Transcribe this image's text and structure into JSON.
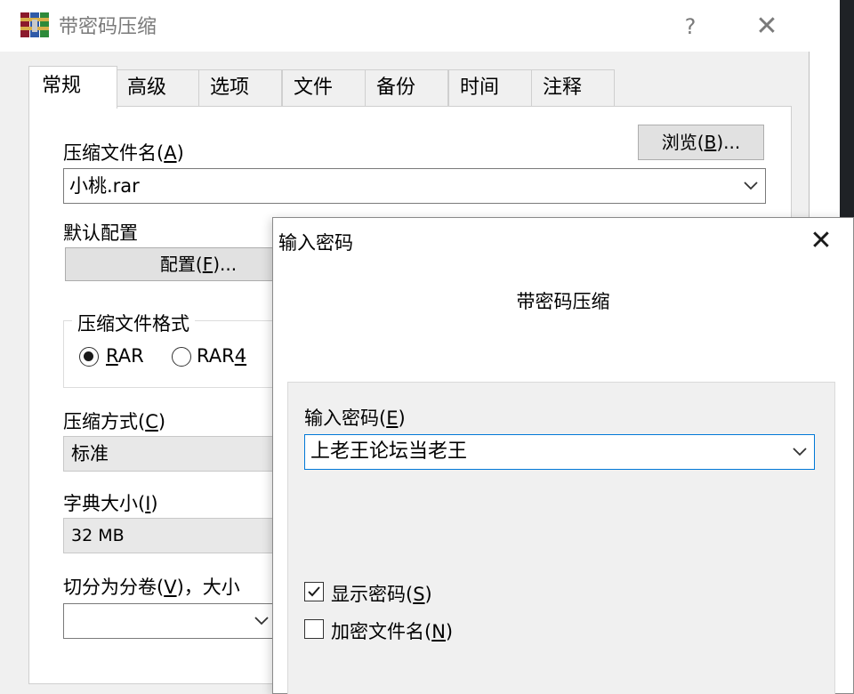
{
  "window": {
    "title": "带密码压缩",
    "help": "?",
    "close": "✕"
  },
  "tabs": [
    "常规",
    "高级",
    "选项",
    "文件",
    "备份",
    "时间",
    "注释"
  ],
  "general": {
    "archive_name_label": "压缩文件名",
    "archive_name_key": "A",
    "browse_label": "浏览",
    "browse_key": "B",
    "browse_suffix": "...",
    "archive_name_value": "小桃.rar",
    "default_profile_label": "默认配置",
    "profile_button_label": "配置",
    "profile_button_key": "F",
    "profile_button_suffix": "...",
    "format_group_title": "压缩文件格式",
    "format_options": [
      {
        "label": "RAR",
        "selected": true
      },
      {
        "label": "RAR4",
        "selected": false
      }
    ],
    "method_label": "压缩方式",
    "method_key": "C",
    "method_value": "标准",
    "dict_label": "字典大小",
    "dict_key": "I",
    "dict_value": "32 MB",
    "split_label": "切分为分卷",
    "split_key": "V",
    "split_suffix": "，大小",
    "split_value": ""
  },
  "password_dialog": {
    "title": "输入密码",
    "close": "✕",
    "subtitle": "带密码压缩",
    "password_label": "输入密码",
    "password_key": "E",
    "password_value": "上老王论坛当老王",
    "show_password_label": "显示密码",
    "show_password_key": "S",
    "show_password_checked": true,
    "encrypt_names_label": "加密文件名",
    "encrypt_names_key": "N",
    "encrypt_names_checked": false
  }
}
